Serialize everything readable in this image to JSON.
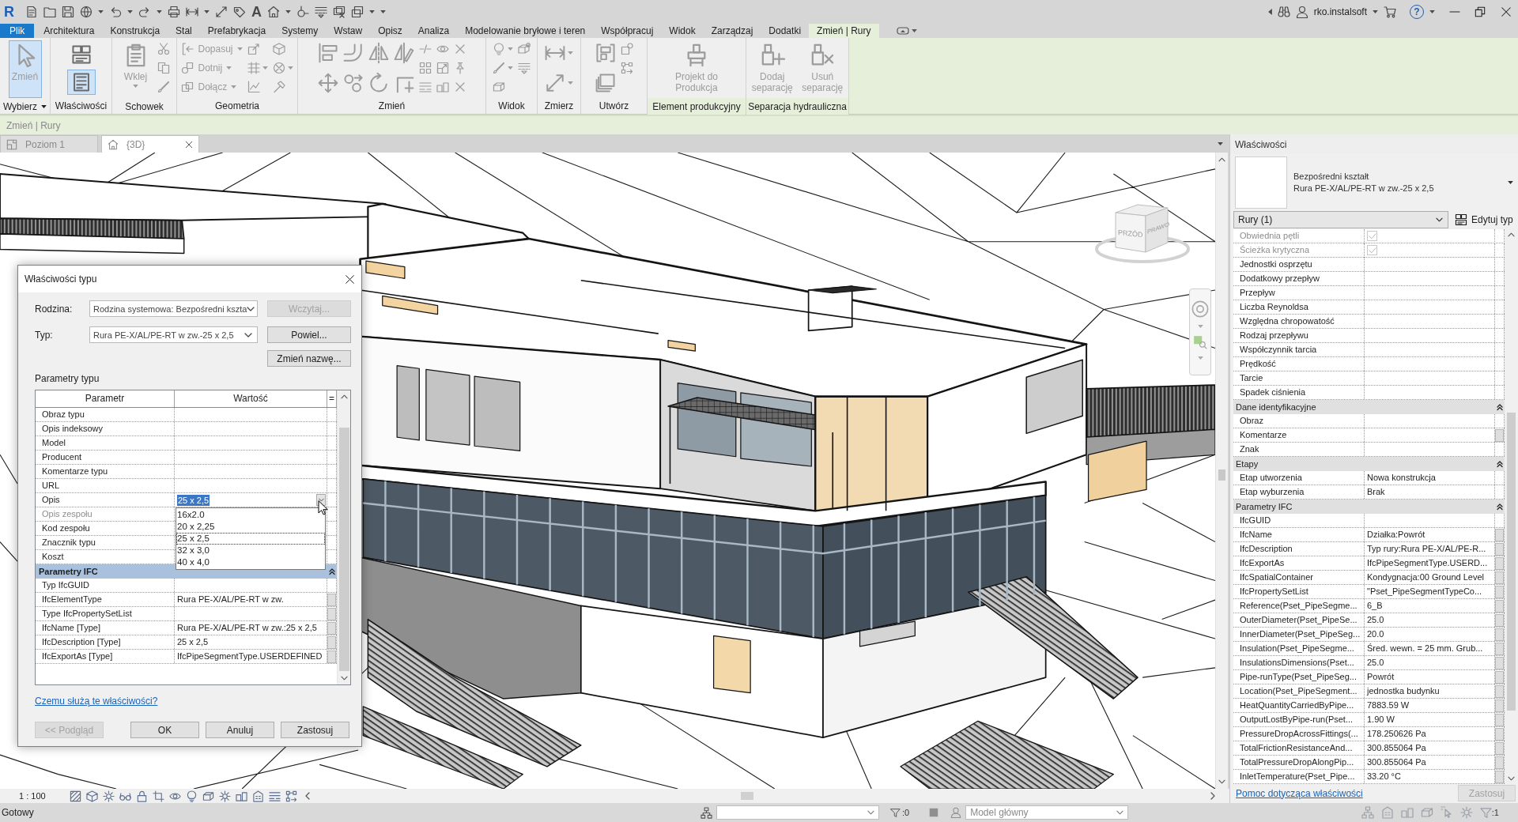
{
  "quick_access": {
    "logo": "R",
    "text_tool": "A",
    "user": "rko.instalsoft",
    "help": "?"
  },
  "ribbon": {
    "tabs": [
      {
        "label": "Plik",
        "kind": "file",
        "selected": false
      },
      {
        "label": "Architektura",
        "kind": "tab",
        "selected": false
      },
      {
        "label": "Konstrukcja",
        "kind": "tab",
        "selected": false
      },
      {
        "label": "Stal",
        "kind": "tab",
        "selected": false
      },
      {
        "label": "Prefabrykacja",
        "kind": "tab",
        "selected": false
      },
      {
        "label": "Systemy",
        "kind": "tab",
        "selected": false
      },
      {
        "label": "Wstaw",
        "kind": "tab",
        "selected": false
      },
      {
        "label": "Opisz",
        "kind": "tab",
        "selected": false
      },
      {
        "label": "Analiza",
        "kind": "tab",
        "selected": false
      },
      {
        "label": "Modelowanie bryłowe i teren",
        "kind": "tab",
        "selected": false
      },
      {
        "label": "Współpracuj",
        "kind": "tab",
        "selected": false
      },
      {
        "label": "Widok",
        "kind": "tab",
        "selected": false
      },
      {
        "label": "Zarządzaj",
        "kind": "tab",
        "selected": false
      },
      {
        "label": "Dodatki",
        "kind": "tab",
        "selected": false
      },
      {
        "label": "Zmień | Rury",
        "kind": "contextual",
        "selected": true
      }
    ],
    "panels": [
      {
        "label": "Wybierz",
        "dropdown": true,
        "contextual": false,
        "tools": [
          {
            "label": "Zmień",
            "kind": "large",
            "dropdown": false,
            "active": true,
            "disabled": true
          }
        ]
      },
      {
        "label": "Właściwości",
        "dropdown": false,
        "contextual": false,
        "tools": [
          {
            "kind": "icon",
            "dropdown": false,
            "active": false,
            "disabled": false
          },
          {
            "kind": "icon",
            "dropdown": false,
            "active": true,
            "disabled": false
          }
        ]
      },
      {
        "label": "Schowek",
        "dropdown": false,
        "contextual": false,
        "tools": [
          {
            "label": "Wklej",
            "kind": "large",
            "dropdown": true,
            "active": false,
            "disabled": true
          }
        ]
      },
      {
        "label": "Geometria",
        "dropdown": false,
        "contextual": false,
        "tools": [
          {
            "label": "Dopasuj",
            "kind": "small",
            "dropdown": true,
            "active": false,
            "disabled": true
          },
          {
            "label": "Dotnij",
            "kind": "small",
            "dropdown": true,
            "active": false,
            "disabled": true
          },
          {
            "label": "Dołącz",
            "kind": "small",
            "dropdown": true,
            "active": false,
            "disabled": true
          }
        ]
      },
      {
        "label": "Zmień",
        "dropdown": false,
        "contextual": false
      },
      {
        "label": "Widok",
        "dropdown": false,
        "contextual": false
      },
      {
        "label": "Zmierz",
        "dropdown": false,
        "contextual": false
      },
      {
        "label": "Utwórz",
        "dropdown": false,
        "contextual": false
      },
      {
        "label": "Element produkcyjny",
        "dropdown": false,
        "contextual": true,
        "tools": [
          {
            "label": "Projekt do Produkcja",
            "kind": "large",
            "dropdown": false,
            "active": false,
            "disabled": true
          }
        ]
      },
      {
        "label": "Separacja hydrauliczna",
        "dropdown": false,
        "contextual": true,
        "tools": [
          {
            "label": "Dodaj separację",
            "kind": "large",
            "dropdown": false,
            "active": false,
            "disabled": true
          },
          {
            "label": "Usuń separację",
            "kind": "large",
            "dropdown": false,
            "active": false,
            "disabled": true
          }
        ]
      }
    ]
  },
  "context_bar": {
    "text": "Zmień | Rury"
  },
  "views": {
    "tabs": [
      {
        "label": "Poziom 1",
        "kind": "plan",
        "selected": false
      },
      {
        "label": "{3D}",
        "kind": "model",
        "selected": true
      }
    ],
    "viewcube": {
      "front": "PRZÓD",
      "right": "PRAWO"
    },
    "scale": "1 : 100"
  },
  "properties": {
    "title": "Właściwości",
    "type_family": "Bezpośredni kształt",
    "type_name": "Rura PE-X/AL/PE-RT w zw.-25 x 2,5",
    "filter": "Rury (1)",
    "edit_type": "Edytuj typ",
    "rows": [
      {
        "kind": "checkbox",
        "name": "Obwiednia pętli",
        "checked": true,
        "disabled": true,
        "button": false
      },
      {
        "kind": "checkbox",
        "name": "Ścieżka krytyczna",
        "checked": true,
        "disabled": true,
        "button": false
      },
      {
        "kind": "text",
        "name": "Jednostki osprzętu",
        "disabled": false,
        "button": false
      },
      {
        "kind": "text",
        "name": "Dodatkowy przepływ",
        "disabled": false,
        "button": false
      },
      {
        "kind": "text",
        "name": "Przepływ",
        "disabled": false,
        "button": false
      },
      {
        "kind": "text",
        "name": "Liczba Reynoldsa",
        "disabled": false,
        "button": false
      },
      {
        "kind": "text",
        "name": "Względna chropowatość",
        "disabled": false,
        "button": false
      },
      {
        "kind": "text",
        "name": "Rodzaj przepływu",
        "disabled": false,
        "button": false
      },
      {
        "kind": "text",
        "name": "Współczynnik tarcia",
        "disabled": false,
        "button": false
      },
      {
        "kind": "text",
        "name": "Prędkość",
        "disabled": false,
        "button": false
      },
      {
        "kind": "text",
        "name": "Tarcie",
        "disabled": false,
        "button": false
      },
      {
        "kind": "text",
        "name": "Spadek ciśnienia",
        "disabled": false,
        "button": false
      },
      {
        "kind": "group",
        "name": "Dane identyfikacyjne",
        "expanded": true
      },
      {
        "kind": "text",
        "name": "Obraz",
        "disabled": false,
        "button": false
      },
      {
        "kind": "text",
        "name": "Komentarze",
        "disabled": false,
        "button": true
      },
      {
        "kind": "text",
        "name": "Znak",
        "disabled": false,
        "button": false
      },
      {
        "kind": "group",
        "name": "Etapy",
        "expanded": true
      },
      {
        "kind": "text",
        "name": "Etap utworzenia",
        "value": "Nowa konstrukcja",
        "disabled": false,
        "button": false
      },
      {
        "kind": "text",
        "name": "Etap wyburzenia",
        "value": "Brak",
        "disabled": false,
        "button": false
      },
      {
        "kind": "group",
        "name": "Parametry IFC",
        "expanded": true
      },
      {
        "kind": "text",
        "name": "IfcGUID",
        "disabled": false,
        "button": false
      },
      {
        "kind": "text",
        "name": "IfcName",
        "value": "Działka:Powrót",
        "disabled": false,
        "button": true
      },
      {
        "kind": "text",
        "name": "IfcDescription",
        "value": "Typ rury:Rura PE-X/AL/PE-R...",
        "disabled": false,
        "button": true
      },
      {
        "kind": "text",
        "name": "IfcExportAs",
        "value": "IfcPipeSegmentType.USERD...",
        "disabled": false,
        "button": true
      },
      {
        "kind": "text",
        "name": "IfcSpatialContainer",
        "value": "Kondygnacja:00 Ground Level",
        "disabled": false,
        "button": true
      },
      {
        "kind": "text",
        "name": "IfcPropertySetList",
        "value": "\"Pset_PipeSegmentTypeCo...",
        "disabled": false,
        "button": true
      },
      {
        "kind": "text",
        "name": "Reference(Pset_PipeSegme...",
        "value": "6_B",
        "disabled": false,
        "button": true
      },
      {
        "kind": "text",
        "name": "OuterDiameter(Pset_PipeSe...",
        "value": "25.0",
        "disabled": false,
        "button": true
      },
      {
        "kind": "text",
        "name": "InnerDiameter(Pset_PipeSeg...",
        "value": "20.0",
        "disabled": false,
        "button": true
      },
      {
        "kind": "text",
        "name": "Insulation(Pset_PipeSegme...",
        "value": "Śred. wewn. = 25 mm. Grub...",
        "disabled": false,
        "button": true
      },
      {
        "kind": "text",
        "name": "InsulationsDimensions(Pset...",
        "value": "25.0",
        "disabled": false,
        "button": true
      },
      {
        "kind": "text",
        "name": "Pipe-runType(Pset_PipeSeg...",
        "value": "Powrót",
        "disabled": false,
        "button": true
      },
      {
        "kind": "text",
        "name": "Location(Pset_PipeSegment...",
        "value": "jednostka budynku",
        "disabled": false,
        "button": true
      },
      {
        "kind": "text",
        "name": "HeatQuantityCarriedByPipe...",
        "value": "7883.59 W",
        "disabled": false,
        "button": true
      },
      {
        "kind": "text",
        "name": "OutputLostByPipe-run(Pset...",
        "value": "1.90 W",
        "disabled": false,
        "button": true
      },
      {
        "kind": "text",
        "name": "PressureDropAcrossFittings(...",
        "value": "178.250626 Pa",
        "disabled": false,
        "button": true
      },
      {
        "kind": "text",
        "name": "TotalFrictionResistanceAnd...",
        "value": "300.855064 Pa",
        "disabled": false,
        "button": true
      },
      {
        "kind": "text",
        "name": "TotalPressureDropAlongPip...",
        "value": "300.855064 Pa",
        "disabled": false,
        "button": true
      },
      {
        "kind": "text",
        "name": "InletTemperature(Pset_Pipe...",
        "value": "33.20 °C",
        "disabled": false,
        "button": true
      }
    ],
    "help_link": "Pomoc dotycząca właściwości",
    "apply": {
      "label": "Zastosuj",
      "disabled": true
    }
  },
  "dialog": {
    "title": "Właściwości typu",
    "family_label": "Rodzina:",
    "family": "Rodzina systemowa: Bezpośredni kszta",
    "type_label": "Typ:",
    "type": "Rura PE-X/AL/PE-RT w zw.-25 x 2,5",
    "side_buttons": [
      {
        "label": "Wczytaj...",
        "disabled": true
      },
      {
        "label": "Powiel...",
        "disabled": false
      },
      {
        "label": "Zmień nazwę...",
        "disabled": false
      }
    ],
    "section": "Parametry typu",
    "columns": [
      "Parametr",
      "Wartość",
      "="
    ],
    "rows": [
      {
        "kind": "text",
        "name": "Obraz typu",
        "disabled": false,
        "button": false
      },
      {
        "kind": "text",
        "name": "Opis indeksowy",
        "disabled": false,
        "button": false
      },
      {
        "kind": "text",
        "name": "Model",
        "disabled": false,
        "button": false
      },
      {
        "kind": "text",
        "name": "Producent",
        "disabled": false,
        "button": false
      },
      {
        "kind": "text",
        "name": "Komentarze typu",
        "disabled": false,
        "button": false
      },
      {
        "kind": "text",
        "name": "URL",
        "disabled": false,
        "button": false
      },
      {
        "kind": "dropdown",
        "name": "Opis",
        "value": "25 x 2,5",
        "expanded": true,
        "disabled": false,
        "button": false,
        "options": [
          {
            "label": "16x2.0",
            "selected": false
          },
          {
            "label": "20 x 2,25",
            "selected": false
          },
          {
            "label": "25 x 2,5",
            "selected": true
          },
          {
            "label": "32 x 3,0",
            "selected": false
          },
          {
            "label": "40 x 4,0",
            "selected": false
          }
        ]
      },
      {
        "kind": "text",
        "name": "Opis zespołu",
        "disabled": true,
        "button": false
      },
      {
        "kind": "text",
        "name": "Kod zespołu",
        "disabled": false,
        "button": false
      },
      {
        "kind": "text",
        "name": "Znacznik typu",
        "disabled": false,
        "button": false
      },
      {
        "kind": "text",
        "name": "Koszt",
        "disabled": false,
        "button": false
      },
      {
        "kind": "group",
        "name": "Parametry IFC",
        "expanded": true
      },
      {
        "kind": "text",
        "name": "Typ IfcGUID",
        "disabled": false,
        "button": false
      },
      {
        "kind": "text",
        "name": "IfcElementType",
        "value": "Rura PE-X/AL/PE-RT w zw.",
        "disabled": false,
        "button": true
      },
      {
        "kind": "text",
        "name": "Type IfcPropertySetList",
        "disabled": false,
        "button": true
      },
      {
        "kind": "text",
        "name": "IfcName [Type]",
        "value": "Rura PE-X/AL/PE-RT w zw.:25 x 2,5",
        "disabled": false,
        "button": true
      },
      {
        "kind": "text",
        "name": "IfcDescription [Type]",
        "value": "25 x 2,5",
        "disabled": false,
        "button": true
      },
      {
        "kind": "text",
        "name": "IfcExportAs [Type]",
        "value": "IfcPipeSegmentType.USERDEFINED",
        "disabled": false,
        "button": true
      }
    ],
    "help_link": "Czemu służą te właściwości?",
    "buttons": [
      {
        "label": "<< Podgląd",
        "disabled": true
      },
      {
        "label": "OK",
        "disabled": false
      },
      {
        "label": "Anuluj",
        "disabled": false
      },
      {
        "label": "Zastosuj",
        "disabled": false
      }
    ]
  },
  "status_bar": {
    "text": "Gotowy",
    "filter_count": ":0",
    "model": "Model główny",
    "selection_count": ":1"
  }
}
